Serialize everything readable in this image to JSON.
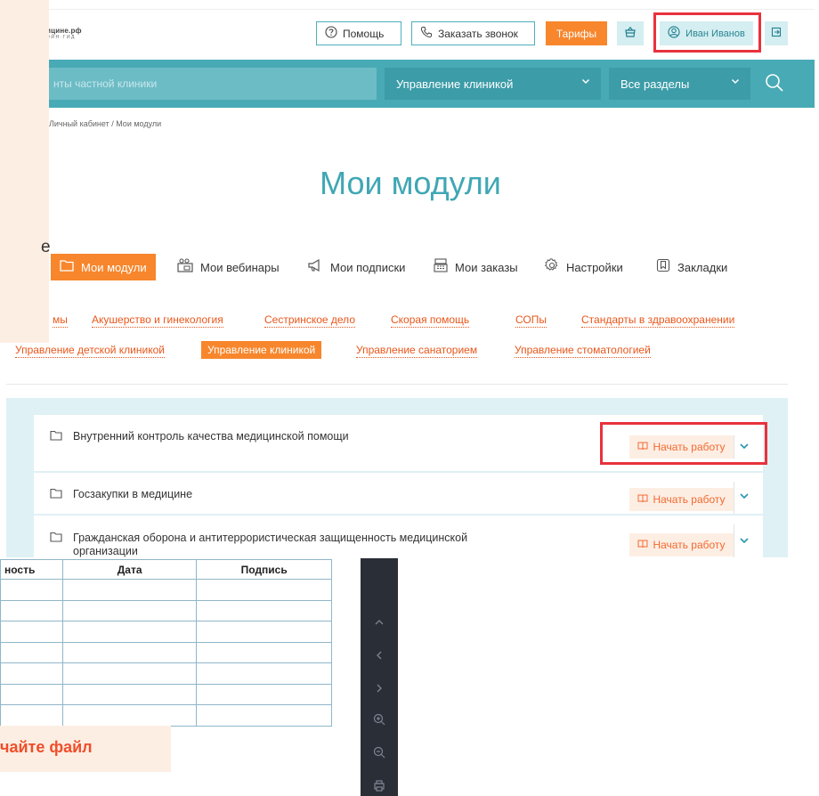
{
  "header": {
    "logo_line1": "ицине.рф",
    "logo_line2": "ОЙН·ГИД",
    "help_label": "Помощь",
    "callback_label": "Заказать звонок",
    "tariffs_label": "Тарифы",
    "user_name": "Иван Иванов"
  },
  "search": {
    "placeholder": "нты частной клиники",
    "category_selected": "Управление клиникой",
    "section_selected": "Все разделы"
  },
  "breadcrumb": "Личный кабинет  /  Мои модули",
  "page_title": "Мои модули",
  "tabs": [
    {
      "label": "Мои модули",
      "icon": "folder-icon",
      "active": true
    },
    {
      "label": "Мои вебинары",
      "icon": "webinar-icon",
      "active": false
    },
    {
      "label": "Мои подписки",
      "icon": "megaphone-icon",
      "active": false
    },
    {
      "label": "Мои заказы",
      "icon": "cash-register-icon",
      "active": false
    },
    {
      "label": "Настройки",
      "icon": "gear-icon",
      "active": false
    },
    {
      "label": "Закладки",
      "icon": "bookmark-icon",
      "active": false
    }
  ],
  "tags_row1": [
    "мы",
    "Акушерство и гинекология",
    "Сестринское дело",
    "Скорая помощь",
    "СОПы",
    "Стандарты в здравоохранении"
  ],
  "tags_row2": [
    "Управление детской клиникой",
    "Управление клиникой",
    "Управление санаторием",
    "Управление стоматологией"
  ],
  "active_tag": "Управление клиникой",
  "modules": [
    {
      "title": "Внутренний контроль качества медицинской помощи",
      "action": "Начать работу"
    },
    {
      "title": "Госзакупки в медицине",
      "action": "Начать работу"
    },
    {
      "title_line1": "Гражданская оборона и антитеррористическая защищенность медицинской",
      "title_line2": "организации",
      "action": "Начать работу"
    }
  ],
  "overlay_fragment": "е",
  "background_doc": {
    "table_headers": [
      "ность",
      "Дата",
      "Подпись"
    ],
    "cta_fragment": "чайте файл"
  },
  "colors": {
    "accent_orange": "#f7862c",
    "teal": "#48aab5",
    "teal_dark": "#3c9ca8",
    "highlight_red": "#e8323c",
    "panel_bg": "#dff1f5"
  }
}
